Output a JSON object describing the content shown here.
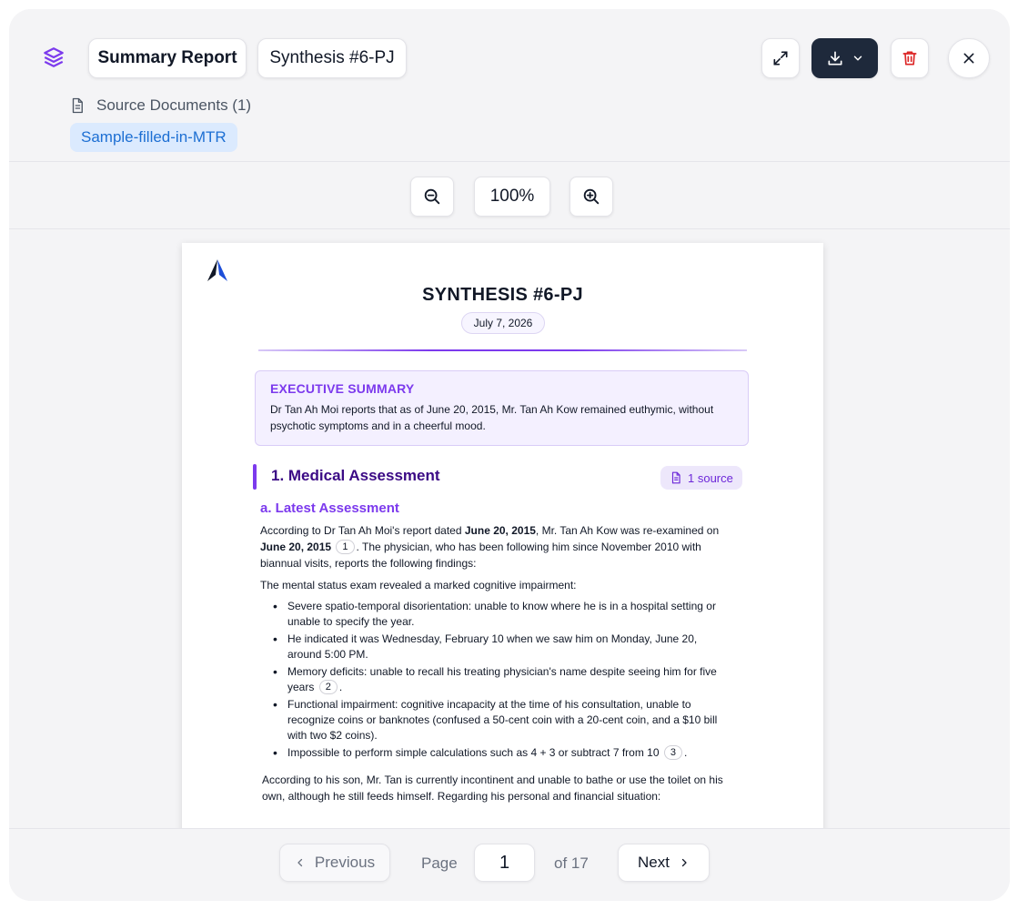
{
  "header": {
    "tabs": [
      {
        "label": "Summary Report"
      },
      {
        "label": "Synthesis #6-PJ"
      }
    ],
    "source_documents_label": "Source Documents (1)",
    "source_chip": "Sample-filled-in-MTR"
  },
  "zoom": {
    "value": "100%"
  },
  "document": {
    "title": "SYNTHESIS #6-PJ",
    "date": "July 7, 2026",
    "executive_summary": {
      "title": "EXECUTIVE SUMMARY",
      "body": "Dr Tan Ah Moi reports that as of June 20, 2015, Mr. Tan Ah Kow remained euthymic, without psychotic symptoms and in a cheerful mood."
    },
    "section": {
      "title": "1. Medical Assessment",
      "source_pill": "1 source",
      "subtitle": "a. Latest Assessment",
      "p1": {
        "t1": "According to Dr Tan Ah Moi's report dated ",
        "b1": "June 20, 2015",
        "t2": ", Mr. Tan Ah Kow was re-examined on ",
        "b2": "June 20, 2015",
        "cite": "1",
        "t3": ". The physician, who has been following him since November 2010 with biannual visits, reports the following findings:"
      },
      "p2": "The mental status exam revealed a marked cognitive impairment:",
      "bullets": [
        {
          "text": "Severe spatio-temporal disorientation: unable to know where he is in a hospital setting or unable to specify the year.",
          "cite": ""
        },
        {
          "text": "He indicated it was Wednesday, February 10 when we saw him on Monday, June 20, around 5:00 PM.",
          "cite": ""
        },
        {
          "text": "Memory deficits: unable to recall his treating physician's name despite seeing him for five years",
          "cite": "2",
          "after": "."
        },
        {
          "text": "Functional impairment: cognitive incapacity at the time of his consultation, unable to recognize coins or banknotes (confused a 50-cent coin with a 20-cent coin, and a $10 bill with two $2 coins).",
          "cite": ""
        },
        {
          "text": "Impossible to perform simple calculations such as 4 + 3 or subtract 7 from 10",
          "cite": "3",
          "after": "."
        }
      ],
      "p3": "According to his son, Mr. Tan is currently incontinent and unable to bathe or use the toilet on his own, although he still feeds himself. Regarding his personal and financial situation:"
    }
  },
  "pagination": {
    "previous_label": "Previous",
    "page_label": "Page",
    "current_page": "1",
    "of_label": "of 17",
    "next_label": "Next"
  },
  "colors": {
    "accent_purple": "#7c3aed",
    "download_button": "#1e293b",
    "delete_red": "#dc2626",
    "chip_blue": "#1d6fd3"
  },
  "icons": {
    "app_logo": "layers-icon",
    "expand": "expand-icon",
    "download": "download-icon",
    "delete": "trash-icon",
    "close": "close-icon",
    "document": "document-icon",
    "zoom_out": "zoom-out-icon",
    "zoom_in": "zoom-in-icon"
  }
}
